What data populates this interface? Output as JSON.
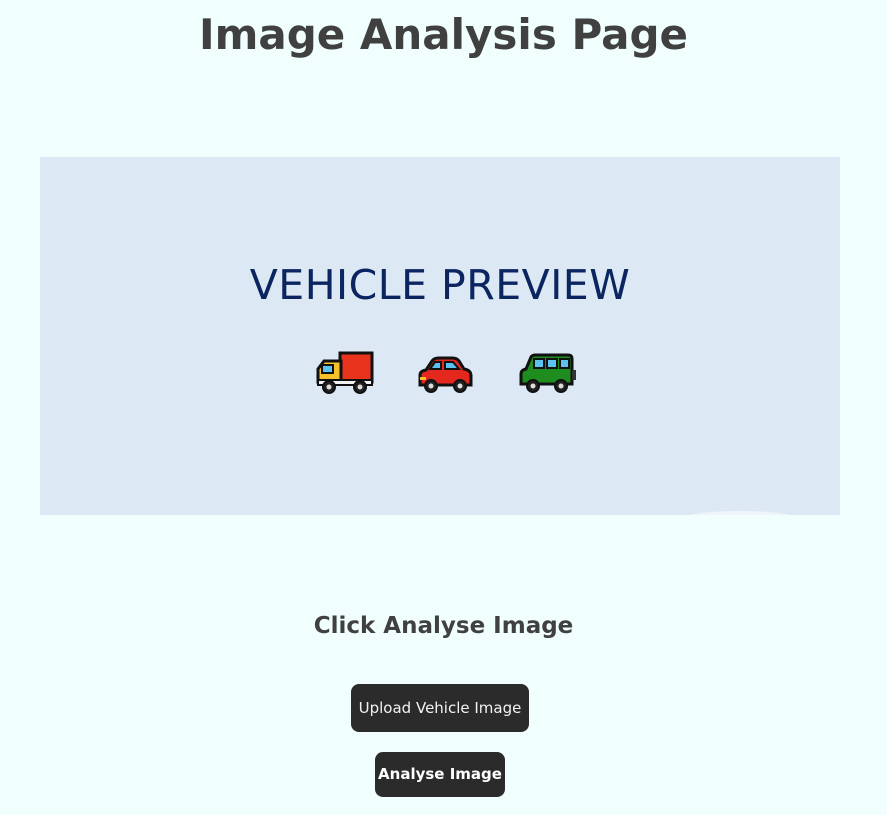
{
  "page": {
    "title": "Image Analysis Page"
  },
  "preview": {
    "text": "VEHICLE PREVIEW",
    "background_color": "#dce9f5",
    "text_color": "#0b2560",
    "vehicles": [
      {
        "icon": "delivery-truck-icon",
        "color": "#e8341c"
      },
      {
        "icon": "car-icon",
        "color": "#e5281e"
      },
      {
        "icon": "suv-icon",
        "color": "#1e8c1e"
      }
    ]
  },
  "instruction": {
    "text": "Click Analyse Image"
  },
  "buttons": {
    "upload_label": "Upload Vehicle Image",
    "analyse_label": "Analyse Image",
    "background_color": "#2b2b2b"
  }
}
